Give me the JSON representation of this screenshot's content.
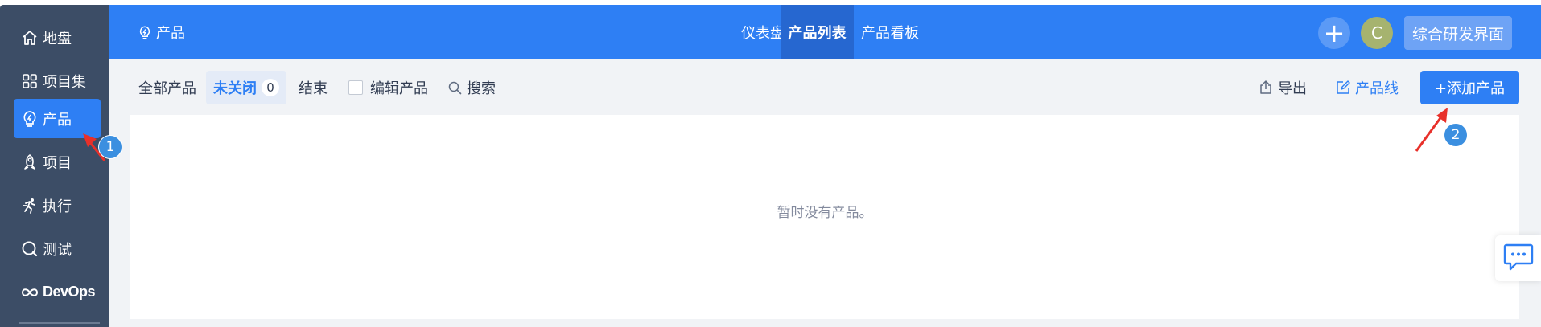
{
  "sidebar": {
    "items": [
      {
        "label": "地盘",
        "icon": "home-icon"
      },
      {
        "label": "项目集",
        "icon": "grid-icon"
      },
      {
        "label": "产品",
        "icon": "lightbulb-icon"
      },
      {
        "label": "项目",
        "icon": "rocket-icon"
      },
      {
        "label": "执行",
        "icon": "running-icon"
      },
      {
        "label": "测试",
        "icon": "search-circle-icon"
      },
      {
        "label": "DevOps",
        "icon": "infinity-icon"
      }
    ],
    "active_index": 2
  },
  "header": {
    "app_title": "产品",
    "tabs": [
      "仪表盘",
      "产品列表",
      "产品看板"
    ],
    "active_tab": 1,
    "plus_label": "+",
    "avatar_letter": "C",
    "workspace_button": "综合研发界面"
  },
  "toolbar": {
    "all_label": "全部产品",
    "active_filter_label": "未关闭",
    "active_filter_count": "0",
    "ended_label": "结束",
    "edit_label": "编辑产品",
    "search_label": "搜索",
    "export_label": "导出",
    "product_line_label": "产品线",
    "add_label": "+添加产品"
  },
  "main": {
    "empty_message": "暂时没有产品。"
  },
  "annotations": {
    "marker_1": "1",
    "marker_2": "2"
  },
  "colors": {
    "primary": "#2e7ff4",
    "sidebar": "#3c4d66",
    "annotation_arrow": "#e8302a",
    "marker": "#3b8fe0"
  }
}
